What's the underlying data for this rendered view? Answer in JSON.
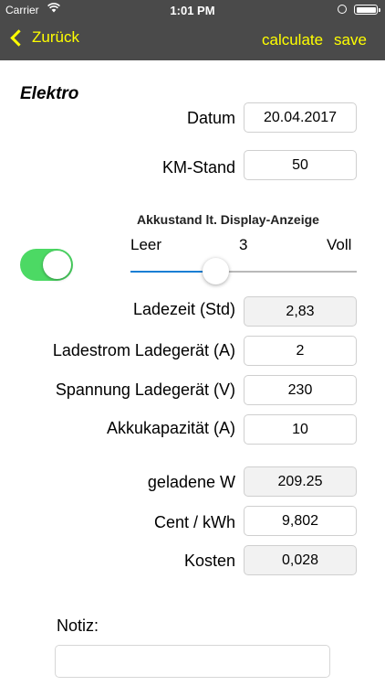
{
  "status_bar": {
    "carrier": "Carrier",
    "time": "1:01 PM"
  },
  "nav": {
    "back_label": "Zurück",
    "calculate_label": "calculate",
    "save_label": "save",
    "accent_color": "#ffff00"
  },
  "section": {
    "title": "Elektro"
  },
  "fields": {
    "datum": {
      "label": "Datum",
      "value": "20.04.2017"
    },
    "km_stand": {
      "label": "KM-Stand",
      "value": "50"
    }
  },
  "akku": {
    "title": "Akkustand lt. Display-Anzeige",
    "min_label": "Leer",
    "max_label": "Voll",
    "value_text": "3",
    "slider_fraction": 0.38,
    "toggle_on": true
  },
  "charging": {
    "ladezeit": {
      "label": "Ladezeit (Std)",
      "value": "2,83"
    },
    "ladestrom": {
      "label": "Ladestrom Ladegerät (A)",
      "value": "2"
    },
    "spannung": {
      "label": "Spannung Ladegerät (V)",
      "value": "230"
    },
    "akkukapazitaet": {
      "label": "Akkukapazität (A)",
      "value": "10"
    }
  },
  "results": {
    "geladene_w": {
      "label": "geladene W",
      "value": "209.25"
    },
    "cent_kwh": {
      "label": "Cent / kWh",
      "value": "9,802"
    },
    "kosten": {
      "label": "Kosten",
      "value": "0,028"
    }
  },
  "notiz": {
    "label": "Notiz:",
    "value": ""
  }
}
